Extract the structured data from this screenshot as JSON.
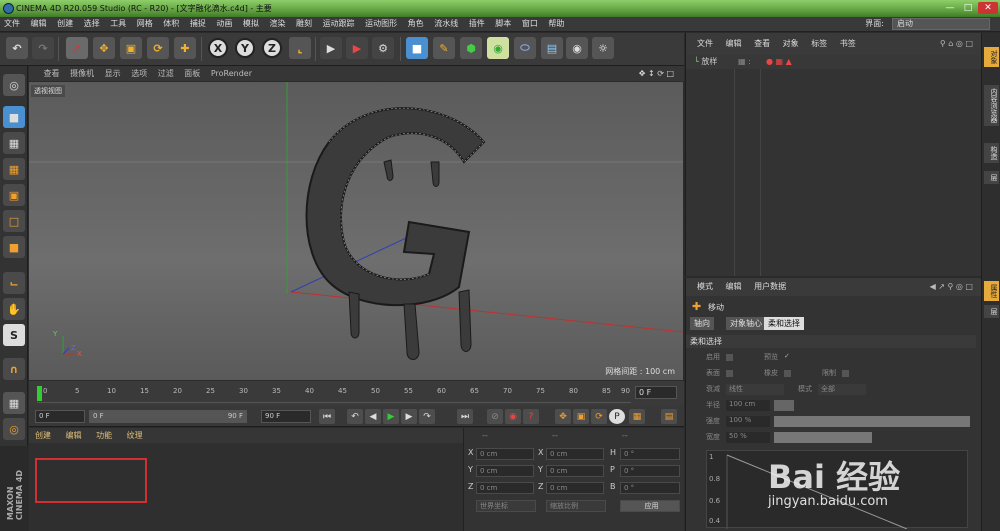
{
  "window": {
    "title": "CINEMA 4D R20.059 Studio (RC - R20) - [文字融化滴水.c4d] - 主要"
  },
  "menubar": {
    "items": [
      "文件",
      "编辑",
      "创建",
      "选择",
      "工具",
      "网格",
      "体积",
      "捕捉",
      "动画",
      "模拟",
      "渲染",
      "雕刻",
      "运动跟踪",
      "运动图形",
      "角色",
      "流水线",
      "插件",
      "脚本",
      "窗口",
      "帮助"
    ],
    "interface_label": "界面:",
    "interface_value": "启动"
  },
  "toolbar": {
    "axis_x": "X",
    "axis_y": "Y",
    "axis_z": "Z"
  },
  "viewport": {
    "menu": [
      "查看",
      "摄像机",
      "显示",
      "选项",
      "过滤",
      "面板",
      "ProRender"
    ],
    "label": "透视视图",
    "grid_info": "网格间距 : 100 cm",
    "axis_labels": {
      "y": "Y",
      "x": "X",
      "z": "Z"
    },
    "object_letter": "G"
  },
  "timeline": {
    "ticks": [
      "0",
      "5",
      "10",
      "15",
      "20",
      "25",
      "30",
      "35",
      "40",
      "45",
      "50",
      "55",
      "60",
      "65",
      "70",
      "75",
      "80",
      "85",
      "90"
    ],
    "current_frame": "0 F"
  },
  "playback": {
    "start": "0 F",
    "range_start": "0 F",
    "range_end": "90 F",
    "end": "90 F"
  },
  "material_panel": {
    "tabs": [
      "创建",
      "编辑",
      "功能",
      "纹理"
    ]
  },
  "coords": {
    "header": [
      "--",
      "--",
      "--"
    ],
    "rows": [
      {
        "a": "X",
        "av": "0 cm",
        "b": "X",
        "bv": "0 cm",
        "c": "H",
        "cv": "0 °"
      },
      {
        "a": "Y",
        "av": "0 cm",
        "b": "Y",
        "bv": "0 cm",
        "c": "P",
        "cv": "0 °"
      },
      {
        "a": "Z",
        "av": "0 cm",
        "b": "Z",
        "bv": "0 cm",
        "c": "B",
        "cv": "0 °"
      }
    ],
    "world_select": "世界坐标",
    "scale_select": "缩放比例",
    "apply_button": "应用"
  },
  "object_manager": {
    "menu": [
      "文件",
      "编辑",
      "查看",
      "对象",
      "标签",
      "书签"
    ],
    "row_label": "放样"
  },
  "attributes": {
    "menu": [
      "模式",
      "编辑",
      "用户数据"
    ],
    "tool_name": "移动",
    "tabs": [
      "轴向",
      "对象轴心",
      "柔和选择"
    ],
    "active_tab": "柔和选择",
    "section": "柔和选择",
    "props": {
      "enable": "启用",
      "preview": "预览",
      "surface": "表面",
      "rubber": "橡皮",
      "restrict": "限制",
      "mode_label": "衰减",
      "mode_value": "线性",
      "mode2_label": "模式",
      "mode2_value": "全部",
      "radius_label": "半径",
      "radius_value": "100 cm",
      "strength_label": "强度",
      "strength_value": "100 %",
      "width_label": "宽度",
      "width_value": "50 %"
    },
    "graph_labels": [
      "1",
      "0.8",
      "0.6",
      "0.4"
    ]
  },
  "right_tabs": [
    "对象",
    "内容浏览器",
    "构造",
    "层",
    "属性",
    "层"
  ],
  "watermark": {
    "text": "Bai 经验",
    "url": "jingyan.baidu.com"
  },
  "brand": {
    "maxon": "MAXON",
    "c4d": "CINEMA 4D"
  },
  "colors": {
    "accent": "#e6a93c",
    "highlight_box": "#d23030"
  }
}
